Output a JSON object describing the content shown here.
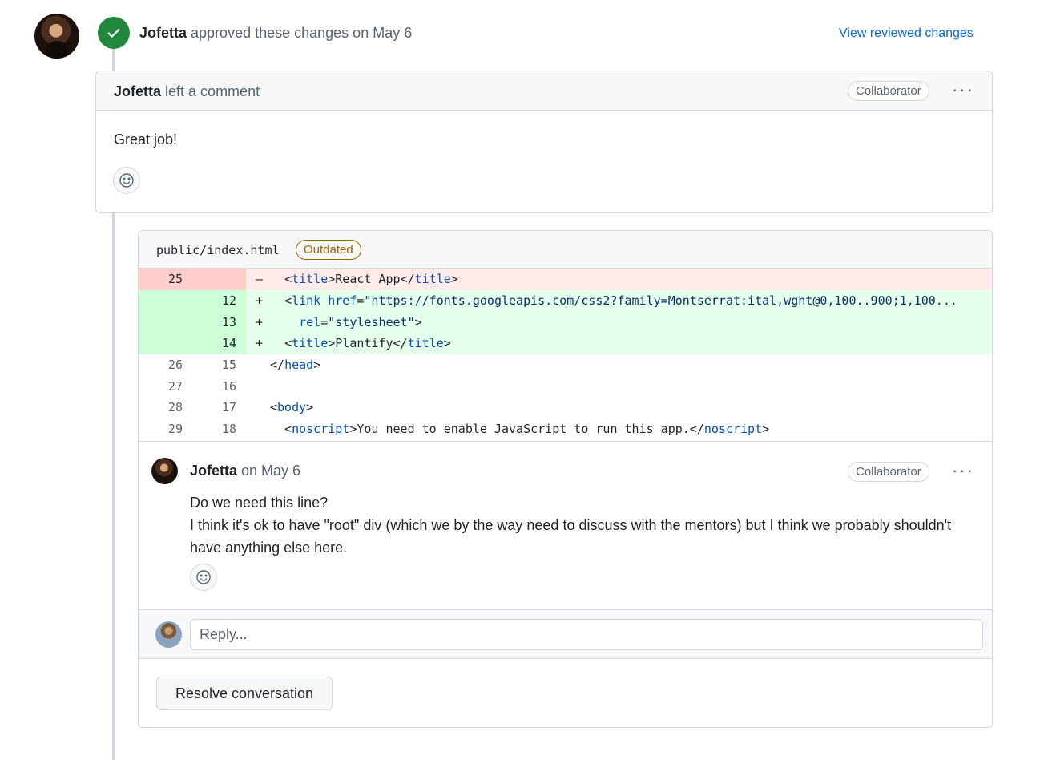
{
  "review_event": {
    "author": "Jofetta",
    "action_text": "approved these changes on May 6",
    "view_link": "View reviewed changes"
  },
  "review_comment": {
    "author": "Jofetta",
    "action": "left a comment",
    "role_badge": "Collaborator",
    "body": "Great job!"
  },
  "file": {
    "path": "public/index.html",
    "status_badge": "Outdated",
    "diff_rows": [
      {
        "type": "del",
        "old": "25",
        "new": "",
        "sign": "–"
      },
      {
        "type": "add",
        "old": "",
        "new": "12",
        "sign": "+"
      },
      {
        "type": "add",
        "old": "",
        "new": "13",
        "sign": "+"
      },
      {
        "type": "add",
        "old": "",
        "new": "14",
        "sign": "+"
      },
      {
        "type": "ctx",
        "old": "26",
        "new": "15",
        "sign": ""
      },
      {
        "type": "ctx",
        "old": "27",
        "new": "16",
        "sign": ""
      },
      {
        "type": "ctx",
        "old": "28",
        "new": "17",
        "sign": ""
      },
      {
        "type": "ctx",
        "old": "29",
        "new": "18",
        "sign": ""
      }
    ],
    "code": {
      "r1": {
        "indent": "  ",
        "lt1": "<",
        "tag": "title",
        "gt1": ">",
        "text": "React App",
        "lt2": "</",
        "tag2": "title",
        "gt2": ">"
      },
      "r2": {
        "indent": "  ",
        "lt": "<",
        "tag": "link",
        "sp": " ",
        "attr": "href",
        "eq": "=",
        "val": "\"https://fonts.googleapis.com/css2?family=Montserrat:ital,wght@0,100..900;1,100..."
      },
      "r3": {
        "indent": "    ",
        "attr": "rel",
        "eq": "=",
        "val": "\"stylesheet\"",
        "gt": ">"
      },
      "r4": {
        "indent": "  ",
        "lt1": "<",
        "tag": "title",
        "gt1": ">",
        "text": "Plantify",
        "lt2": "</",
        "tag2": "title",
        "gt2": ">"
      },
      "r5": {
        "indent": "",
        "lt": "</",
        "tag": "head",
        "gt": ">"
      },
      "r7": {
        "indent": "",
        "lt": "<",
        "tag": "body",
        "gt": ">"
      },
      "r8": {
        "indent": "  ",
        "lt1": "<",
        "tag": "noscript",
        "gt1": ">",
        "text": "You need to enable JavaScript to run this app.",
        "lt2": "</",
        "tag2": "noscript",
        "gt2": ">"
      }
    }
  },
  "thread_comment": {
    "author": "Jofetta",
    "time": "on May 6",
    "role_badge": "Collaborator",
    "line1": "Do we need this line?",
    "line2": "I think it's ok to have \"root\" div (which we by the way need to discuss with the mentors) but I think we probably shouldn't have anything else here."
  },
  "reply": {
    "placeholder": "Reply..."
  },
  "resolve_button": "Resolve conversation",
  "more_options": "···",
  "icons": {
    "approve": "check-icon",
    "reaction": "smiley-icon"
  },
  "colors": {
    "accent_green": "#1f883d",
    "link_blue": "#0969da",
    "outdated": "#9a6700",
    "del_bg": "#ffebe9",
    "add_bg": "#e6ffec"
  }
}
